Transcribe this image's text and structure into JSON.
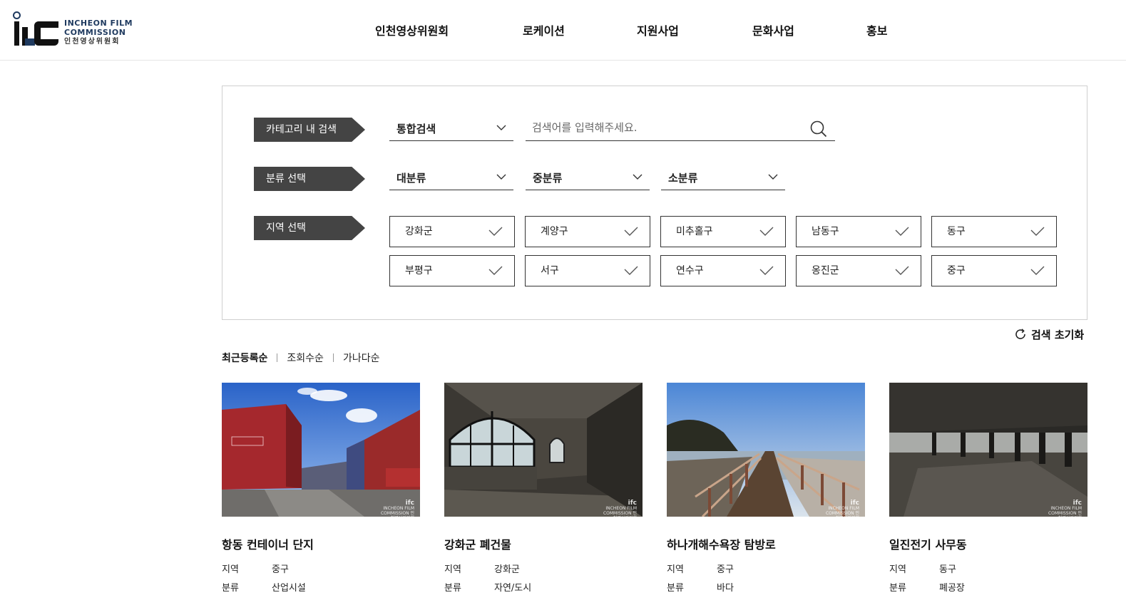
{
  "logo": {
    "en_line1_a": "INCHEON ",
    "en_line1_b": "FILM",
    "en_line2": "COMMISSION",
    "kr": "인천영상위원회"
  },
  "nav": [
    "인천영상위원회",
    "로케이션",
    "지원사업",
    "문화사업",
    "홍보"
  ],
  "search": {
    "category_label": "카테고리 내 검색",
    "category_select": "통합검색",
    "placeholder": "검색어를 입력해주세요.",
    "class_label": "분류 선택",
    "class_selects": [
      "대분류",
      "중분류",
      "소분류"
    ],
    "region_label": "지역 선택",
    "regions": [
      "강화군",
      "계양구",
      "미추홀구",
      "남동구",
      "동구",
      "부평구",
      "서구",
      "연수구",
      "옹진군",
      "중구"
    ]
  },
  "reset_label": "검색 초기화",
  "sort": [
    "최근등록순",
    "조회수순",
    "가나다순"
  ],
  "meta_labels": {
    "region": "지역",
    "category": "분류"
  },
  "cards": [
    {
      "title": "항동 컨테이너 단지",
      "region": "중구",
      "category": "산업시설"
    },
    {
      "title": "강화군 폐건물",
      "region": "강화군",
      "category": "자연/도시"
    },
    {
      "title": "하나개해수욕장 탐방로",
      "region": "중구",
      "category": "바다"
    },
    {
      "title": "일진전기 사무동",
      "region": "동구",
      "category": "폐공장"
    }
  ],
  "watermark": {
    "mark": "ifc",
    "text": "INCHEON FILM COMMISSION 인천영상위원회"
  },
  "colors": {
    "brand": "#1f3a5f",
    "tag_bg": "#444444",
    "text": "#111111"
  }
}
